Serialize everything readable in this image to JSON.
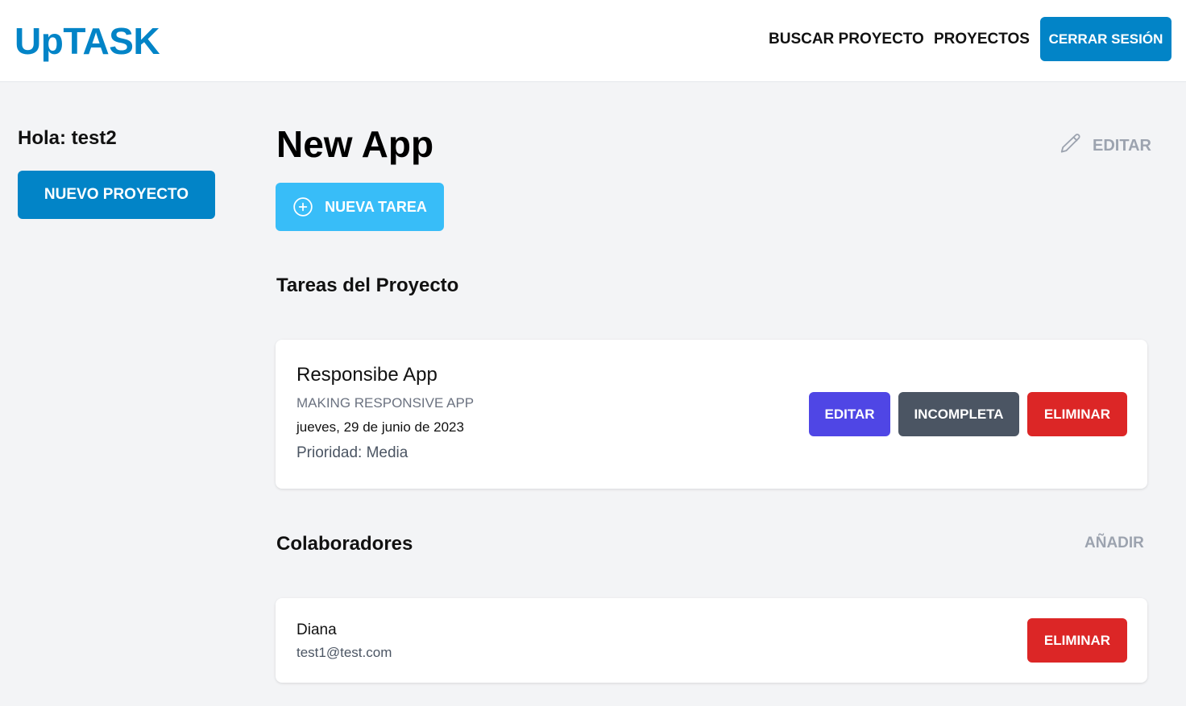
{
  "header": {
    "logo": "UpTASK",
    "nav": [
      {
        "label": "BUSCAR PROYECTO"
      },
      {
        "label": "PROYECTOS"
      }
    ],
    "logout_label": "CERRAR SESIÓN"
  },
  "sidebar": {
    "greeting": "Hola: test2",
    "new_project_label": "NUEVO PROYECTO"
  },
  "project": {
    "title": "New App",
    "edit_label": "EDITAR",
    "edit_icon": "pencil-icon",
    "new_task_label": "NUEVA TAREA",
    "new_task_icon": "plus-circle-icon"
  },
  "tasks_section": {
    "title": "Tareas del Proyecto",
    "tasks": [
      {
        "name": "Responsibe App",
        "description": "MAKING RESPONSIVE APP",
        "date": "jueves, 29 de junio de 2023",
        "priority": "Prioridad: Media",
        "edit_label": "EDITAR",
        "status_label": "INCOMPLETA",
        "delete_label": "ELIMINAR"
      }
    ]
  },
  "collaborators_section": {
    "title": "Colaboradores",
    "add_label": "AÑADIR",
    "collaborators": [
      {
        "name": "Diana",
        "email": "test1@test.com",
        "delete_label": "ELIMINAR"
      }
    ]
  },
  "colors": {
    "brand": "#0284c7",
    "new_task": "#38bdf8",
    "edit": "#4f46e5",
    "incomplete": "#4b5563",
    "delete": "#dc2626",
    "muted": "#9ca3af"
  }
}
